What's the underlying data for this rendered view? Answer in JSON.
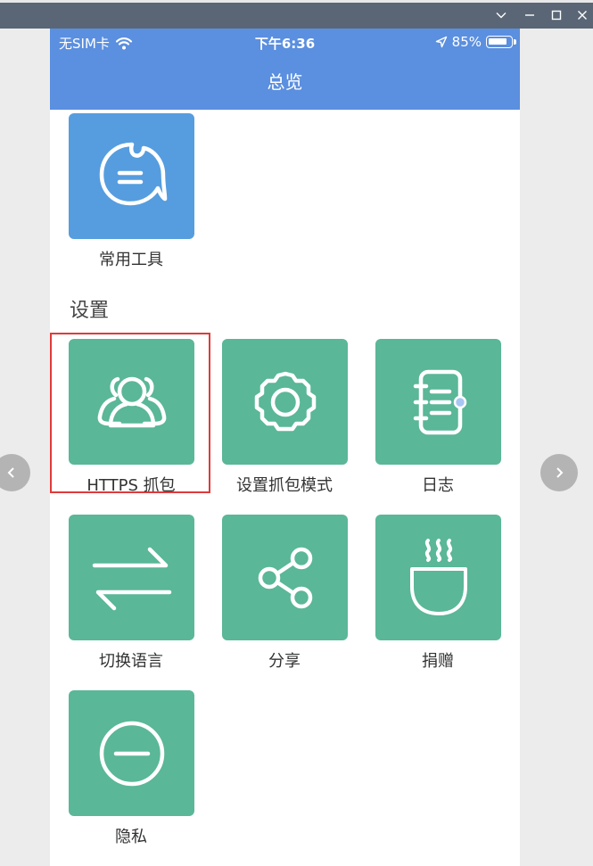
{
  "window": {
    "controls": [
      "chevron-down-icon",
      "minimize-icon",
      "maximize-icon",
      "close-icon"
    ]
  },
  "status_bar": {
    "carrier": "无SIM卡",
    "time": "下午6:36",
    "battery_percent": "85%",
    "battery_level": 0.85
  },
  "nav": {
    "title": "总览"
  },
  "top_item": {
    "label": "常用工具",
    "icon": "chat-bubble-icon"
  },
  "settings": {
    "section_title": "设置",
    "items": [
      {
        "label": "HTTPS 抓包",
        "icon": "users-icon"
      },
      {
        "label": "设置抓包模式",
        "icon": "gear-icon"
      },
      {
        "label": "日志",
        "icon": "notebook-icon"
      },
      {
        "label": "切换语言",
        "icon": "swap-arrows-icon"
      },
      {
        "label": "分享",
        "icon": "share-icon"
      },
      {
        "label": "捐赠",
        "icon": "coffee-cup-icon"
      },
      {
        "label": "隐私",
        "icon": "minus-circle-icon"
      }
    ]
  },
  "colors": {
    "header": "#5b8fdf",
    "tile_blue": "#559ddf",
    "tile_green": "#5ab797",
    "highlight": "#e03a3a"
  }
}
